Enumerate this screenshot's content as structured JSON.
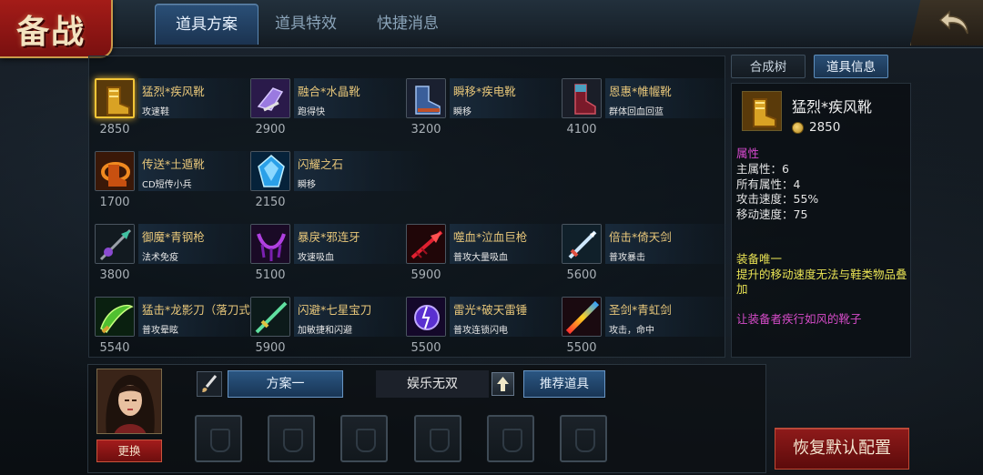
{
  "header": {
    "title": "备战",
    "tabs": [
      {
        "label": "道具方案",
        "active": true
      },
      {
        "label": "道具特效",
        "active": false
      },
      {
        "label": "快捷消息",
        "active": false
      }
    ]
  },
  "items": [
    {
      "name": "猛烈*疾风靴",
      "desc": "攻速鞋",
      "price": "2850",
      "icon": "boot-icon"
    },
    {
      "name": "融合*水晶靴",
      "desc": "跑得快",
      "price": "2900",
      "icon": "crystal-boot-icon"
    },
    {
      "name": "瞬移*疾电靴",
      "desc": "瞬移",
      "price": "3200",
      "icon": "lightning-boot-icon"
    },
    {
      "name": "恩惠*帷幄靴",
      "desc": "群体回血回蓝",
      "price": "4100",
      "icon": "mantle-boot-icon"
    },
    {
      "name": "传送*土遁靴",
      "desc": "CD短传小兵",
      "price": "1700",
      "icon": "teleport-boot-icon"
    },
    {
      "name": "闪耀之石",
      "desc": "瞬移",
      "price": "2150",
      "icon": "crystal-stone-icon"
    },
    {
      "name": "御魔*青钢枪",
      "desc": "法术免疫",
      "price": "3800",
      "icon": "spear-icon"
    },
    {
      "name": "暴戾*邪连牙",
      "desc": "攻速吸血",
      "price": "5100",
      "icon": "claw-icon"
    },
    {
      "name": "噬血*泣血巨枪",
      "desc": "普攻大量吸血",
      "price": "5900",
      "icon": "blood-spear-icon"
    },
    {
      "name": "倍击*倚天剑",
      "desc": "普攻暴击",
      "price": "5600",
      "icon": "sword-icon"
    },
    {
      "name": "猛击*龙影刀（落刀式",
      "desc": "普攻晕眩",
      "price": "5540",
      "icon": "dragon-blade-icon"
    },
    {
      "name": "闪避*七星宝刀",
      "desc": "加敏捷和闪避",
      "price": "5900",
      "icon": "star-blade-icon"
    },
    {
      "name": "雷光*破天雷锤",
      "desc": "普攻连锁闪电",
      "price": "5500",
      "icon": "thunder-hammer-icon"
    },
    {
      "name": "圣剑*青虹剑",
      "desc": "攻击，命中",
      "price": "5500",
      "icon": "holy-sword-icon"
    }
  ],
  "detail": {
    "tabs": [
      {
        "label": "合成树",
        "active": false
      },
      {
        "label": "道具信息",
        "active": true
      }
    ],
    "name": "猛烈*疾风靴",
    "price": "2850",
    "attr_title": "属性",
    "stats": [
      "主属性：6",
      "所有属性：4",
      "攻击速度：55%",
      "移动速度：75"
    ],
    "unique_title": "装备唯一",
    "unique_desc_1": "提升的移动速度无法与鞋类物品叠",
    "unique_desc_2": "加",
    "flavor": "让装备者疾行如风的靴子"
  },
  "bottom": {
    "change_label": "更换",
    "plan_label": "方案一",
    "mode_label": "娱乐无双",
    "recommend_label": "推荐道具",
    "restore_label": "恢复默认配置"
  },
  "colors": {
    "accent_blue": "#2b5682",
    "accent_red": "#8f1a1a",
    "item_name": "#e8c77a",
    "selected_border": "#f3c536"
  }
}
